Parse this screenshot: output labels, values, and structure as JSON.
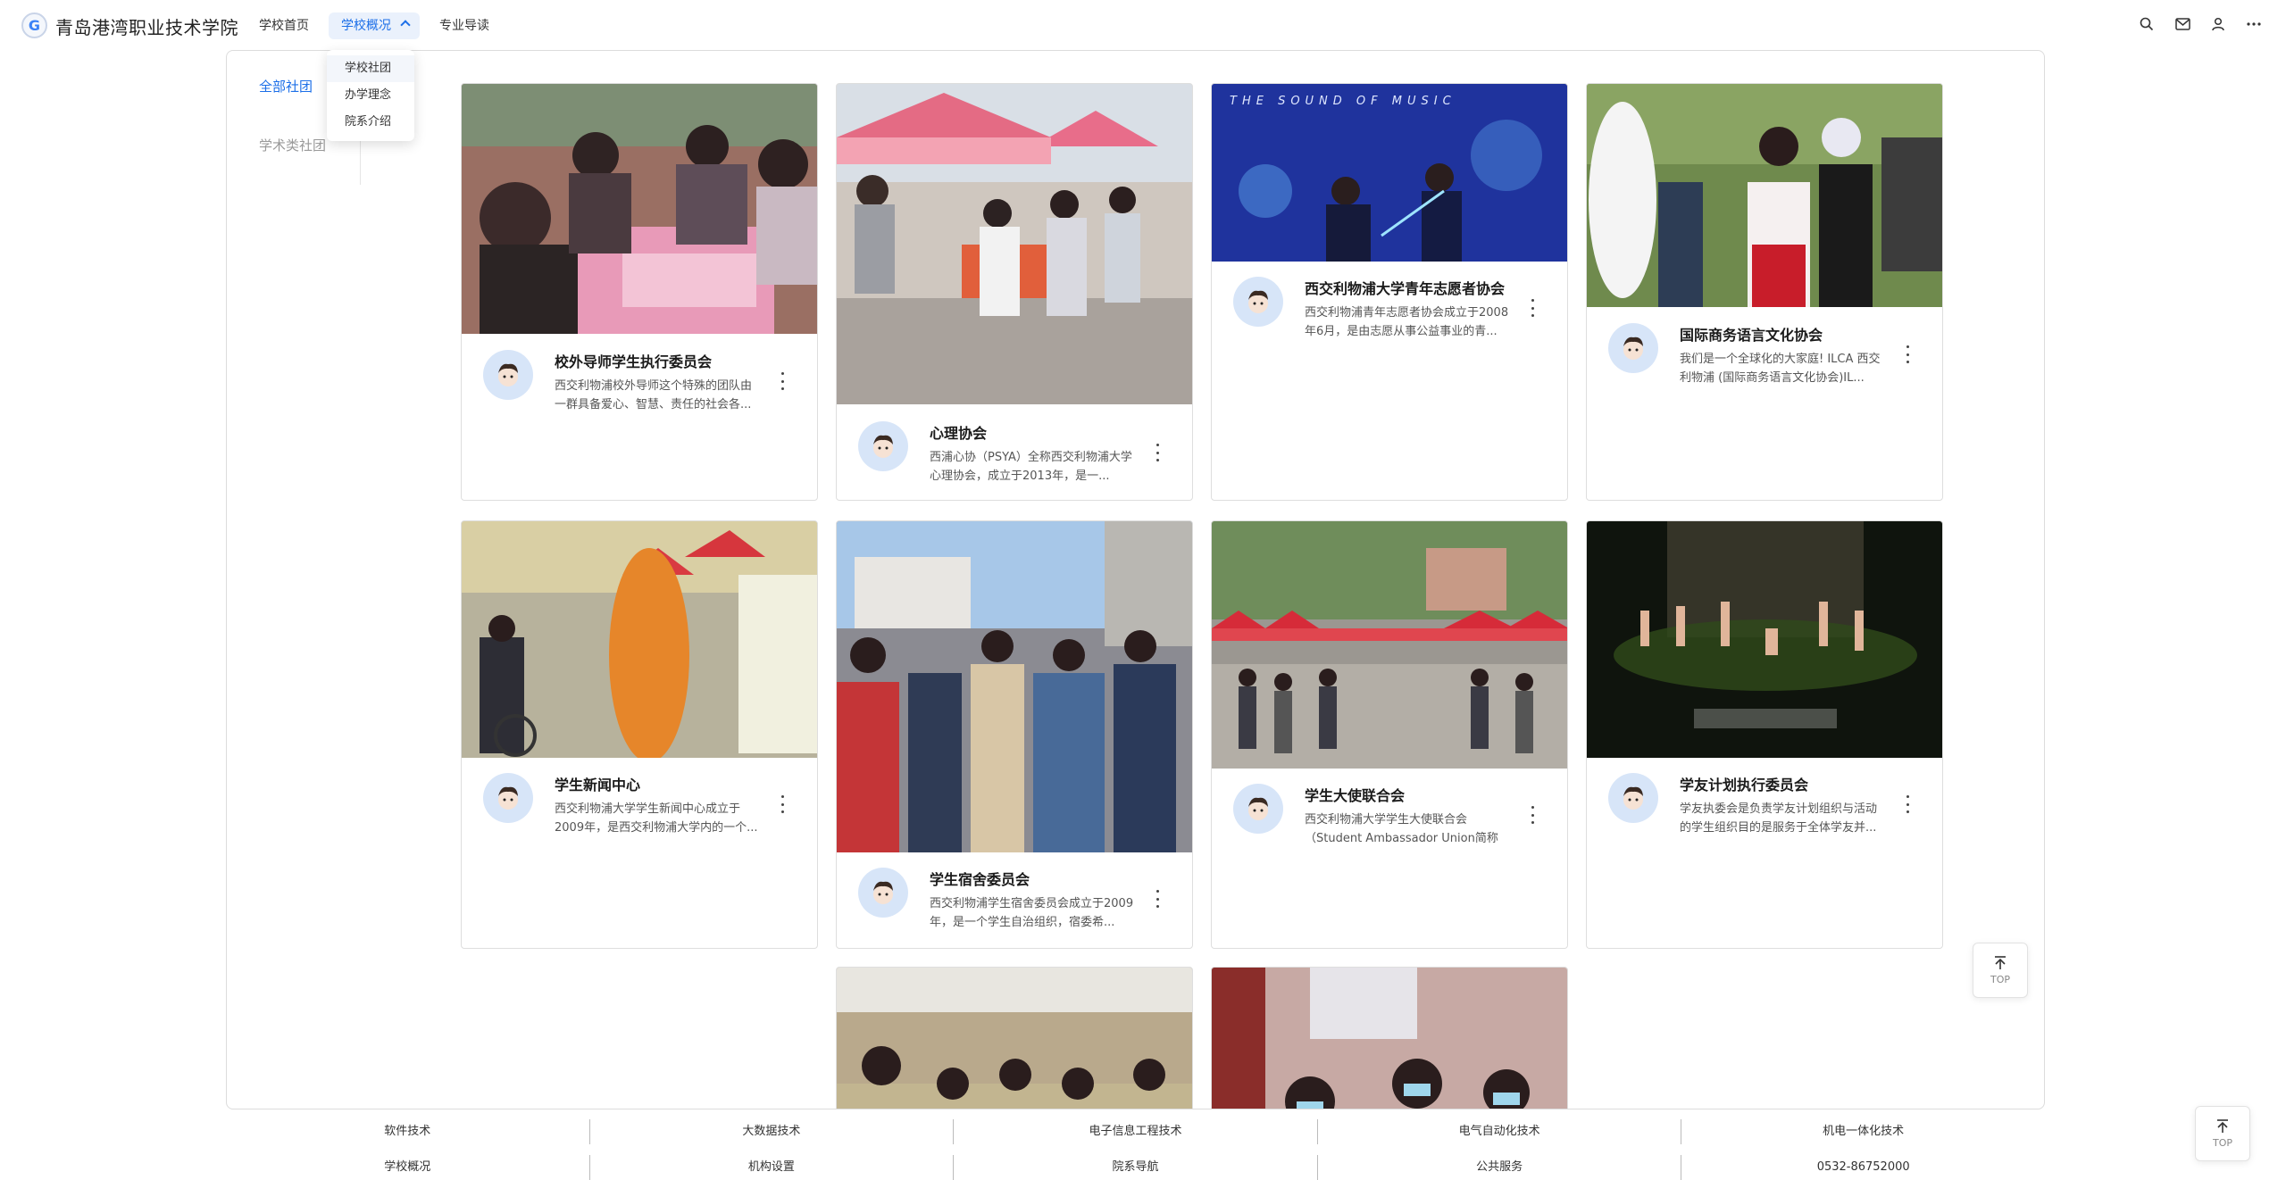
{
  "header": {
    "logo_letter": "G",
    "brand": "青岛港湾职业技术学院",
    "nav": [
      {
        "label": "学校首页",
        "active": false
      },
      {
        "label": "学校概况",
        "active": true
      },
      {
        "label": "专业导读",
        "active": false
      }
    ],
    "icons": [
      "search-icon",
      "mail-icon",
      "user-icon",
      "more-icon"
    ]
  },
  "dropdown": {
    "items": [
      "学校社团",
      "办学理念",
      "院系介绍"
    ]
  },
  "sidebar": {
    "items": [
      {
        "label": "全部社团",
        "active": true
      },
      {
        "label": "学术类社团",
        "active": false
      }
    ]
  },
  "cards": [
    {
      "title": "校外导师学生执行委员会",
      "desc": "西交利物浦校外导师这个特殊的团队由一群具备爱心、智慧、责任的社会各..."
    },
    {
      "title": "心理协会",
      "desc": "西浦心协（PSYA）全称西交利物浦大学心理协会，成立于2013年，是一..."
    },
    {
      "title": "西交利物浦大学青年志愿者协会",
      "desc": "西交利物浦青年志愿者协会成立于2008年6月，是由志愿从事公益事业的青..."
    },
    {
      "title": "国际商务语言文化协会",
      "desc": "我们是一个全球化的大家庭! ILCA 西交利物浦 (国际商务语言文化协会)IL..."
    },
    {
      "title": "学生新闻中心",
      "desc": "西交利物浦大学学生新闻中心成立于2009年，是西交利物浦大学内的一个..."
    },
    {
      "title": "学生宿舍委员会",
      "desc": "西交利物浦学生宿舍委员会成立于2009年，是一个学生自治组织，宿委希..."
    },
    {
      "title": "学生大使联合会",
      "desc": "西交利物浦大学学生大使联合会（Student Ambassador Union简称SAU..."
    },
    {
      "title": "学友计划执行委员会",
      "desc": "学友执委会是负责学友计划组织与活动的学生组织目的是服务于全体学友并..."
    },
    {
      "title": "",
      "desc": ""
    },
    {
      "title": "",
      "desc": ""
    }
  ],
  "photo_overlay_text": "THE SOUND OF MUSIC",
  "top_button": {
    "label": "TOP"
  },
  "footer": {
    "row1": [
      "软件技术",
      "大数据技术",
      "电子信息工程技术",
      "电气自动化技术",
      "机电一体化技术"
    ],
    "row2": [
      "学校概况",
      "机构设置",
      "院系导航",
      "公共服务",
      "0532-86752000"
    ]
  }
}
